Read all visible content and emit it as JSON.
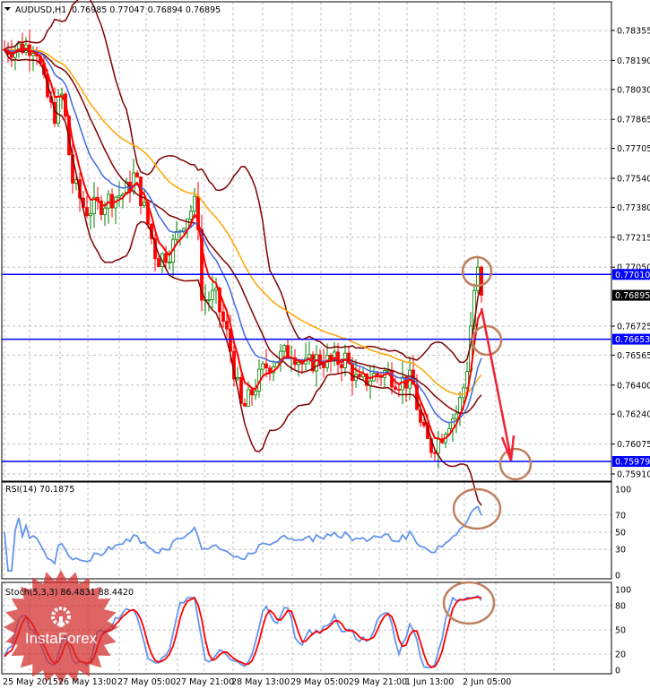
{
  "header": {
    "symbol": "AUDUSD,H1",
    "ohlc": "0.76985 0.77047 0.76894 0.76895"
  },
  "chart_data": [
    {
      "type": "candlestick",
      "title": "AUDUSD,H1",
      "ylim": [
        0.7588,
        0.7847
      ],
      "y_ticks": [
        "0.78355",
        "0.78190",
        "0.78030",
        "0.77865",
        "0.77705",
        "0.77540",
        "0.77380",
        "0.77215",
        "0.77050",
        "0.76725",
        "0.76565",
        "0.76400",
        "0.76240",
        "0.76075",
        "0.75910"
      ],
      "x_ticks": [
        "25 May 2015",
        "26 May 13:00",
        "27 May 05:00",
        "27 May 21:00",
        "28 May 13:00",
        "29 May 05:00",
        "29 May 21:00",
        "1 Jun 13:00",
        "2 Jun 05:00"
      ],
      "closes": [
        0.78251,
        0.78276,
        0.78029,
        0.77881,
        0.78004,
        0.77535,
        0.77362,
        0.77387,
        0.77436,
        0.77461,
        0.7756,
        0.77387,
        0.7709,
        0.7714,
        0.77313,
        0.77411,
        0.76868,
        0.76893,
        0.76646,
        0.76251,
        0.76349,
        0.76498,
        0.76547,
        0.76596,
        0.76498,
        0.76547,
        0.76522,
        0.76547,
        0.76399,
        0.76448,
        0.76473,
        0.76423,
        0.76423,
        0.76152,
        0.76053,
        0.76102,
        0.76201,
        0.76251,
        0.76448,
        0.76843,
        0.77041,
        0.76895
      ],
      "current_price": "0.76895",
      "levels": [
        {
          "price": 0.7701,
          "label": "0.77010"
        },
        {
          "price": 0.76653,
          "label": "0.76653"
        },
        {
          "price": 0.75979,
          "label": "0.75979"
        }
      ],
      "grid": true,
      "colors": {
        "bull": "#008000",
        "bear": "#ff0000",
        "level": "#0000ff",
        "fast_ma": "#ff0000",
        "mid_ma": "#4169e1",
        "slow_ma": "#ffa500",
        "bands": "#800000",
        "annotation": "#c08060",
        "arrow": "#ee2233"
      }
    },
    {
      "type": "line",
      "title": "RSI(14) 70.1875",
      "y_ticks": [
        "100",
        "70",
        "50",
        "30",
        "0"
      ],
      "ylim": [
        0,
        100
      ],
      "color": "#6495ed"
    },
    {
      "type": "line",
      "title": "Stoch(5,3,3) 86.4831 88.4420",
      "y_ticks": [
        "100",
        "80",
        "50",
        "20",
        "0"
      ],
      "ylim": [
        0,
        100
      ],
      "colors": {
        "main": "#6495ed",
        "signal": "#ff0000"
      }
    }
  ],
  "watermark": {
    "text": "InstaForex"
  }
}
